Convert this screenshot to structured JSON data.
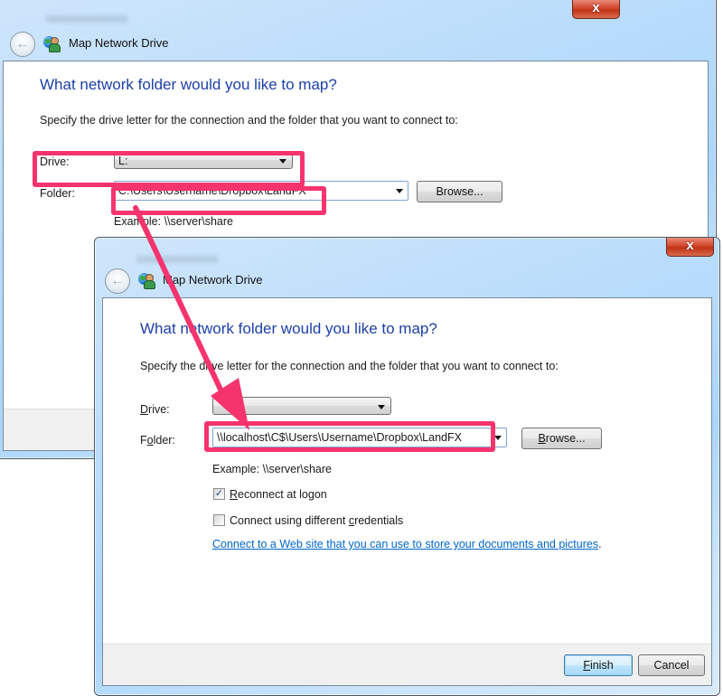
{
  "back_dialog": {
    "title": "Map Network Drive",
    "close_glyph": "x",
    "heading": "What network folder would you like to map?",
    "description": "Specify the drive letter for the connection and the folder that you want to connect to:",
    "drive_label": "Drive:",
    "drive_value": "L:",
    "folder_label": "Folder:",
    "folder_value": "C:\\Users\\Username\\Dropbox\\LandFX",
    "browse_label": "Browse...",
    "example": "Example: \\\\server\\share"
  },
  "front_dialog": {
    "title": "Map Network Drive",
    "close_glyph": "x",
    "heading": "What network folder would you like to map?",
    "description": "Specify the drive letter for the connection and the folder that you want to connect to:",
    "drive_label_mnemonic": "D",
    "drive_label_rest": "rive:",
    "drive_value": "",
    "folder_label_pre": "F",
    "folder_label_mnemonic": "o",
    "folder_label_rest": "lder:",
    "folder_value": "\\\\localhost\\C$\\Users\\Username\\Dropbox\\LandFX",
    "browse_mnemonic": "B",
    "browse_rest": "rowse...",
    "example": "Example: \\\\server\\share",
    "reconnect": {
      "checked": true,
      "check_glyph": "✓",
      "mnemonic": "R",
      "rest": "econnect at logon"
    },
    "credentials": {
      "checked": false,
      "pre": "Connect using different ",
      "mnemonic": "c",
      "rest": "redentials"
    },
    "web_link": "Connect to a Web site that you can use to store your documents and pictures",
    "web_link_suffix": ".",
    "finish_mnemonic": "F",
    "finish_rest": "inish",
    "cancel_label": "Cancel"
  },
  "annotations": {
    "highlight_color": "#f5346e",
    "arrow_color": "#f5346e"
  },
  "icons": {
    "back": "back-arrow-icon",
    "app": "map-network-drive-icon",
    "close": "close-icon",
    "dropdown": "chevron-down-icon",
    "check": "checkmark-icon"
  }
}
